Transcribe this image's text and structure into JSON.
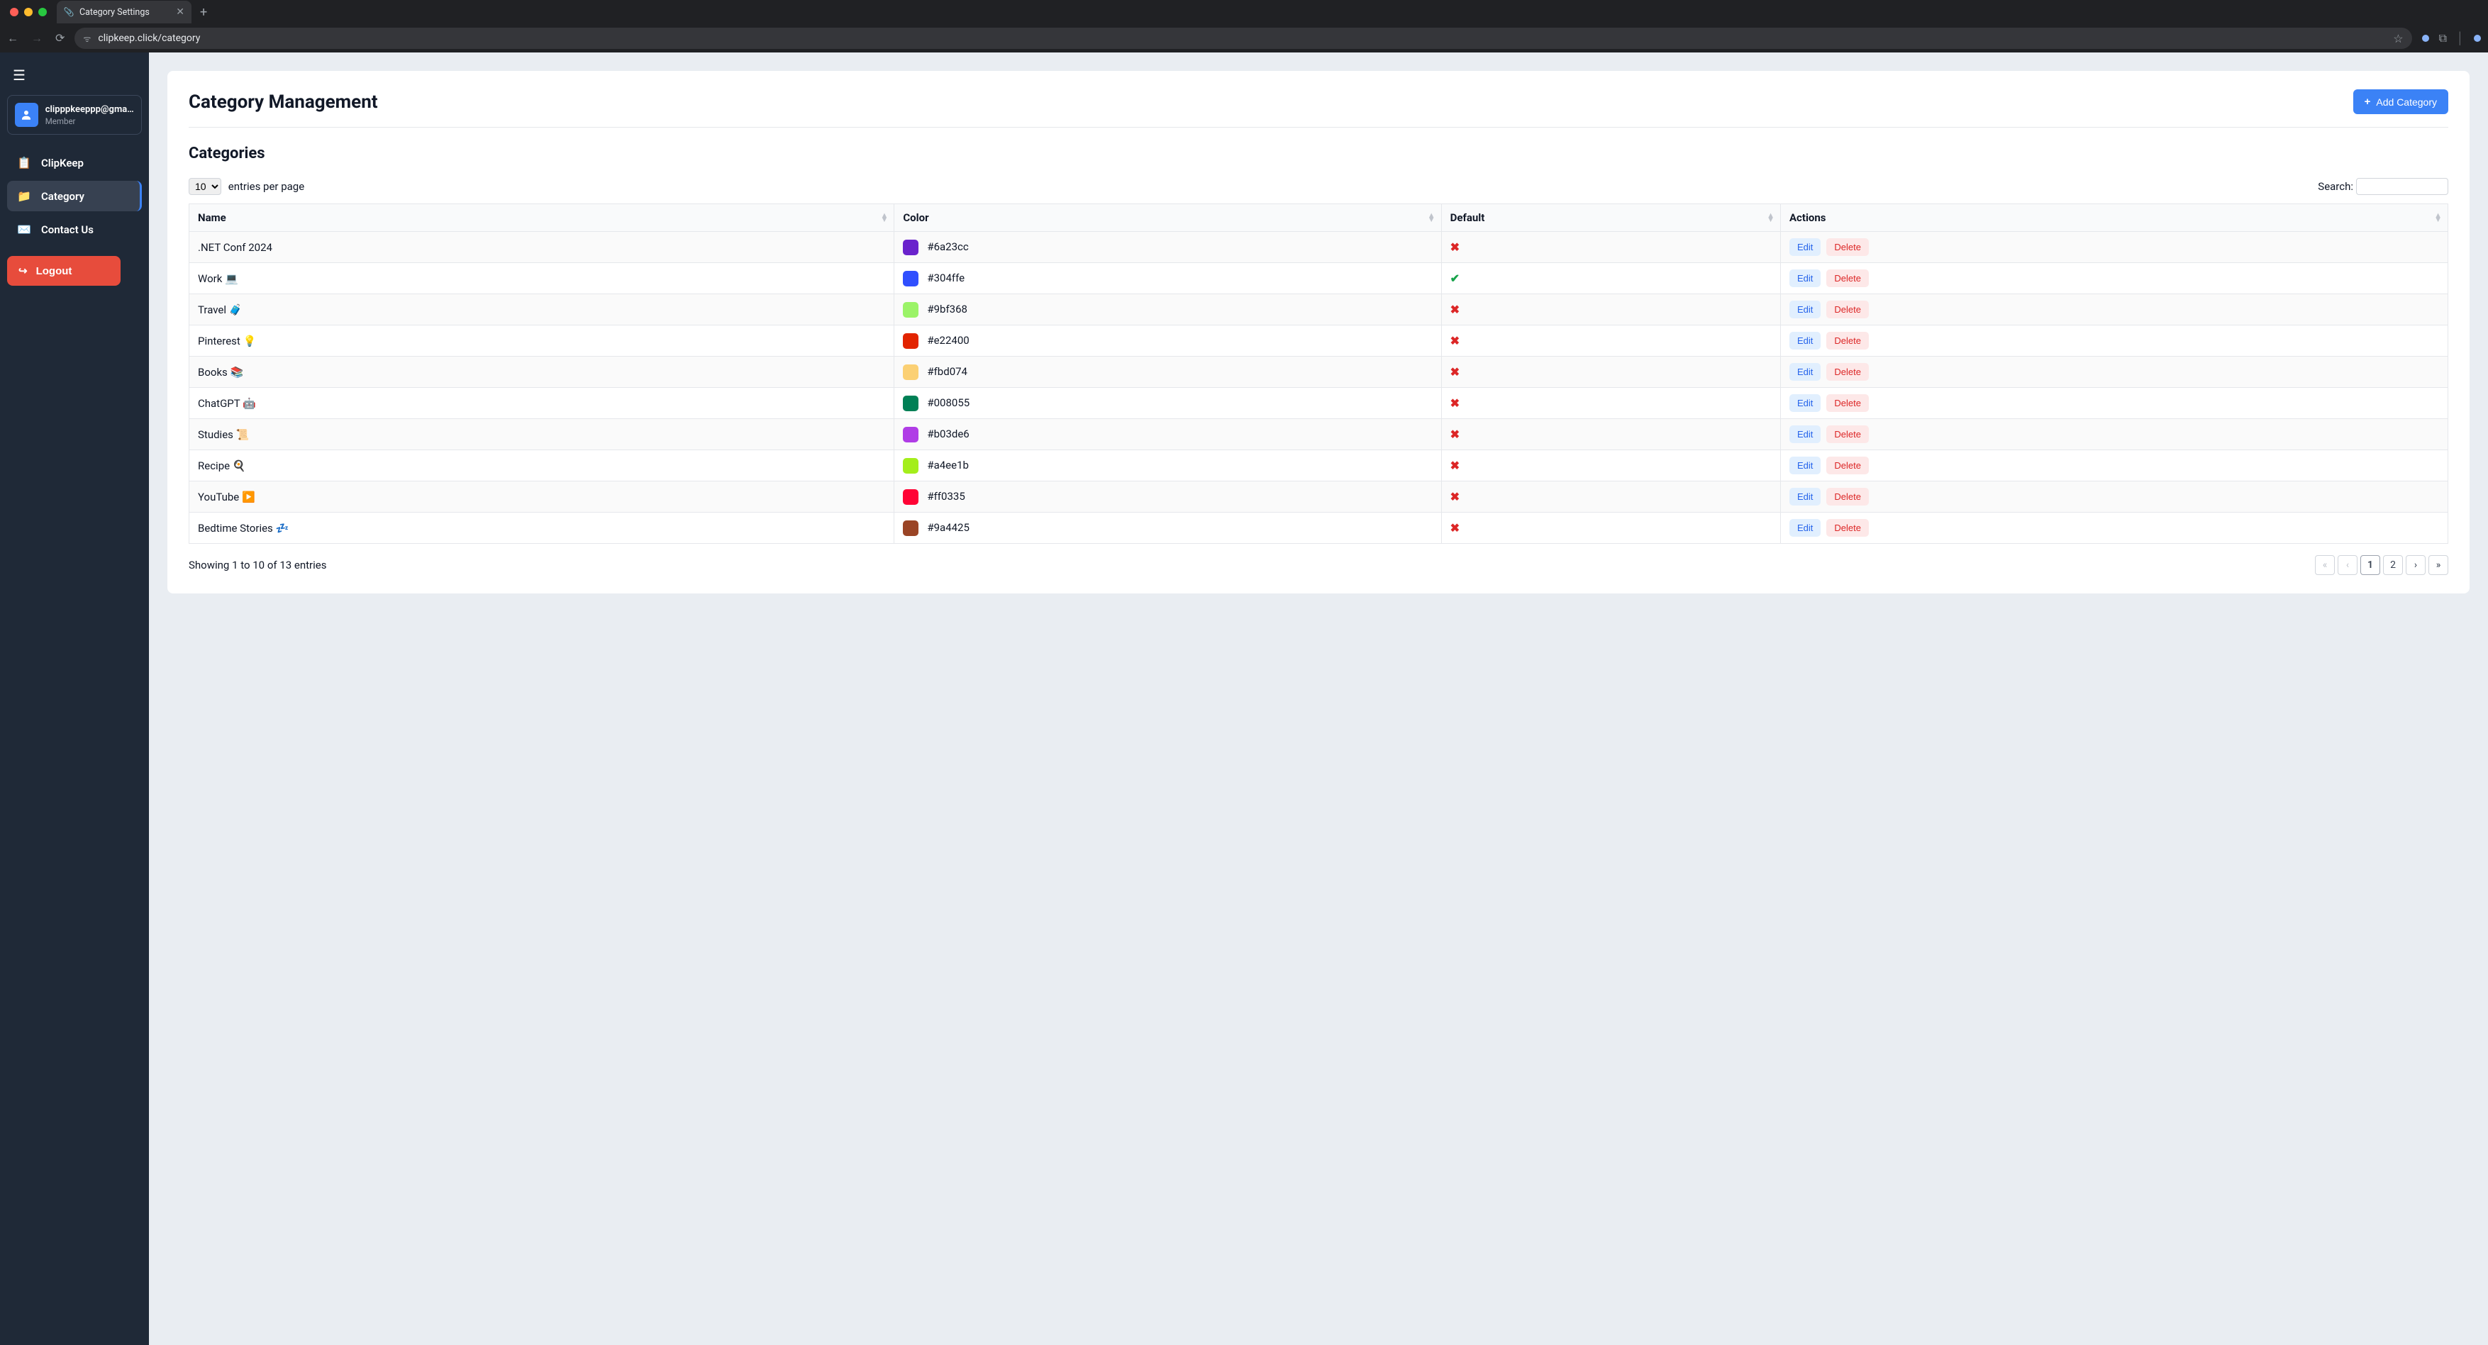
{
  "browser": {
    "tab_title": "Category Settings",
    "url": "clipkeep.click/category"
  },
  "sidebar": {
    "user_email": "clipppkeeppp@gmai...",
    "user_role": "Member",
    "items": [
      {
        "label": "ClipKeep",
        "icon": "clipboard"
      },
      {
        "label": "Category",
        "icon": "folder"
      },
      {
        "label": "Contact Us",
        "icon": "envelope"
      }
    ],
    "logout": "Logout"
  },
  "page": {
    "title": "Category Management",
    "add_button": "Add Category",
    "subheading": "Categories",
    "entries_per_page_suffix": "entries per page",
    "entries_value": "10",
    "search_label": "Search:",
    "search_value": ""
  },
  "columns": {
    "name": "Name",
    "color": "Color",
    "default": "Default",
    "actions": "Actions"
  },
  "actions": {
    "edit": "Edit",
    "delete": "Delete"
  },
  "rows": [
    {
      "name": ".NET Conf 2024",
      "color": "#6a23cc",
      "default": false
    },
    {
      "name": "Work 💻",
      "color": "#304ffe",
      "default": true
    },
    {
      "name": "Travel 🧳",
      "color": "#9bf368",
      "default": false
    },
    {
      "name": "Pinterest 💡",
      "color": "#e22400",
      "default": false
    },
    {
      "name": "Books 📚",
      "color": "#fbd074",
      "default": false
    },
    {
      "name": "ChatGPT 🤖",
      "color": "#008055",
      "default": false
    },
    {
      "name": "Studies 📜",
      "color": "#b03de6",
      "default": false
    },
    {
      "name": "Recipe 🍳",
      "color": "#a4ee1b",
      "default": false
    },
    {
      "name": "YouTube ▶️",
      "color": "#ff0335",
      "default": false
    },
    {
      "name": "Bedtime Stories 💤",
      "color": "#9a4425",
      "default": false
    }
  ],
  "footer": {
    "info": "Showing 1 to 10 of 13 entries",
    "pages": [
      "«",
      "‹",
      "1",
      "2",
      "›",
      "»"
    ],
    "active_page": "1"
  }
}
